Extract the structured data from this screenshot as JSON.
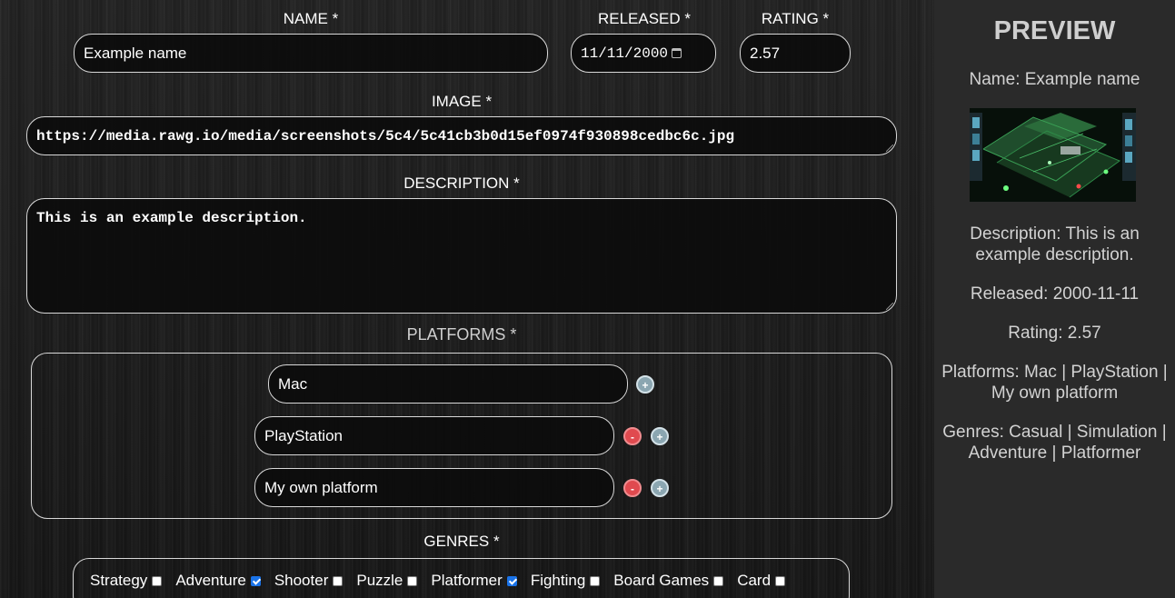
{
  "form": {
    "name_label": "NAME *",
    "name_value": "Example name",
    "released_label": "RELEASED *",
    "released_value": "11/11/2000",
    "rating_label": "RATING *",
    "rating_value": "2.57",
    "image_label": "IMAGE *",
    "image_value": "https://media.rawg.io/media/screenshots/5c4/5c41cb3b0d15ef0974f930898cedbc6c.jpg",
    "description_label": "DESCRIPTION *",
    "description_value": "This is an example description.",
    "platforms_label": "PLATFORMS *",
    "platforms": [
      {
        "value": "Mac"
      },
      {
        "value": "PlayStation"
      },
      {
        "value": "My own platform"
      }
    ],
    "add_symbol": "+",
    "remove_symbol": "-",
    "genres_label": "GENRES *",
    "genres": [
      {
        "label": "Strategy",
        "checked": false
      },
      {
        "label": "Adventure",
        "checked": true
      },
      {
        "label": "Shooter",
        "checked": false
      },
      {
        "label": "Puzzle",
        "checked": false
      },
      {
        "label": "Platformer",
        "checked": true
      },
      {
        "label": "Fighting",
        "checked": false
      },
      {
        "label": "Board Games",
        "checked": false
      },
      {
        "label": "Card",
        "checked": false
      }
    ]
  },
  "preview": {
    "title": "PREVIEW",
    "name": "Name: Example name",
    "description": "Description: This is an example description.",
    "released": "Released: 2000-11-11",
    "rating": "Rating: 2.57",
    "platforms": "Platforms: Mac | PlayStation | My own platform",
    "genres": "Genres: Casual | Simulation | Adventure | Platformer"
  },
  "colors": {
    "add_button": "#8ba6b1",
    "remove_button": "#e04a4f",
    "checkbox_checked": "#1a73e8",
    "sidebar_bg": "#2a2a2a"
  },
  "icons": {
    "date_picker": "calendar-icon",
    "add": "plus-circle-icon",
    "remove": "minus-circle-icon"
  }
}
